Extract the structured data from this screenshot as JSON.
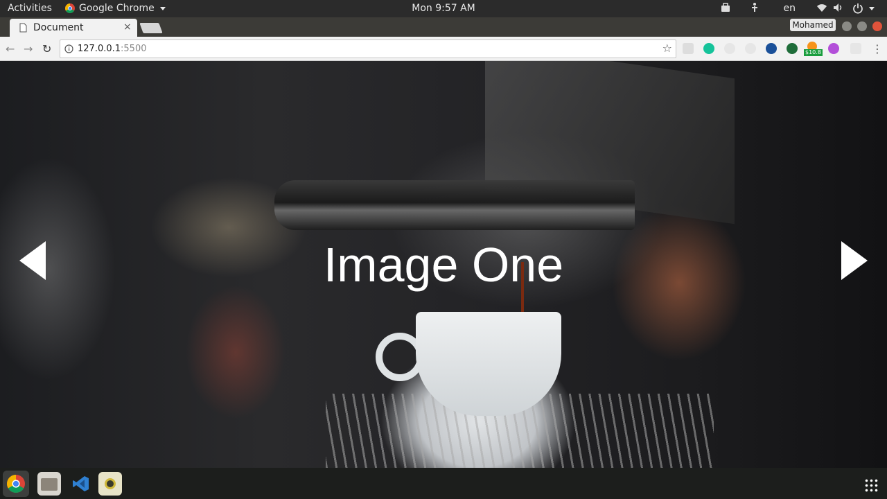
{
  "topbar": {
    "activities": "Activities",
    "app_name": "Google Chrome",
    "clock": "Mon  9:57 AM",
    "language": "en"
  },
  "browser": {
    "tab_title": "Document",
    "tab_close": "×",
    "profile_name": "Mohamed",
    "url_host": "127.0.0.1",
    "url_port": ":5500",
    "extension_badge": "$10.8"
  },
  "slider": {
    "caption": "Image One"
  },
  "colors": {
    "close_button": "#e0533b",
    "min_button": "#8a8a85",
    "grammarly": "#15c39a",
    "chrome_dock": "#f0f0f0"
  }
}
